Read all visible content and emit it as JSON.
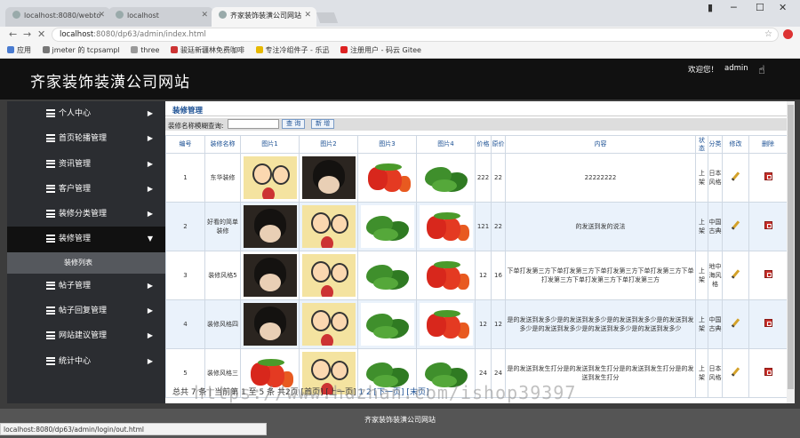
{
  "browser": {
    "tabs": [
      {
        "label": "localhost:8080/webto"
      },
      {
        "label": "localhost"
      },
      {
        "label": "齐家装饰装潢公司网站"
      }
    ],
    "url_host": "localhost",
    "url_path": ":8080/dp63/admin/index.html",
    "bookmarks": [
      "应用",
      "jmeter 的 tcpsampl",
      "three",
      "骏廷新疆林免费咖啡",
      "专注冷组件子 - 乐迅",
      "注册用户 - 码云 Gitee"
    ]
  },
  "header": {
    "title": "齐家装饰装潢公司网站",
    "welcome": "欢迎您！",
    "username": "admin"
  },
  "sidebar": {
    "items": [
      {
        "label": "个人中心"
      },
      {
        "label": "首页轮播管理"
      },
      {
        "label": "资讯管理"
      },
      {
        "label": "客户管理"
      },
      {
        "label": "装修分类管理"
      },
      {
        "label": "装修管理"
      },
      {
        "label": "帖子管理"
      },
      {
        "label": "帖子回复管理"
      },
      {
        "label": "网站建议管理"
      },
      {
        "label": "统计中心"
      }
    ],
    "sub_item": "装修列表"
  },
  "main": {
    "breadcrumb": "装修管理",
    "search_label": "装修名称模糊查询:",
    "search_value": "",
    "query_button": "查 询",
    "add_button": "新 增",
    "columns": [
      "编号",
      "装修名称",
      "图片1",
      "图片2",
      "图片3",
      "图片4",
      "价格",
      "原价",
      "内容",
      "状态",
      "分类",
      "修改",
      "删除"
    ],
    "rows": [
      {
        "id": "1",
        "name": "东华装修",
        "imgs": [
          "cartoon",
          "dark",
          "pepper",
          "spinach"
        ],
        "price": "222",
        "orig": "22",
        "content": "22222222",
        "status": "上架",
        "cat": "日本风格"
      },
      {
        "id": "2",
        "name": "好看的简单装修",
        "imgs": [
          "dark",
          "cartoon",
          "spinach",
          "pepper"
        ],
        "price": "121",
        "orig": "22",
        "content": "的发送到发的说法",
        "status": "上架",
        "cat": "中国古典"
      },
      {
        "id": "3",
        "name": "装修风格5",
        "imgs": [
          "dark",
          "cartoon",
          "spinach",
          "pepper"
        ],
        "price": "12",
        "orig": "16",
        "content": "下单打发第三方下单打发第三方下单打发第三方下单打发第三方下单打发第三方下单打发第三方下单打发第三方",
        "status": "上架",
        "cat": "地中海风格"
      },
      {
        "id": "4",
        "name": "装修风格四",
        "imgs": [
          "dark",
          "cartoon",
          "spinach",
          "pepper"
        ],
        "price": "12",
        "orig": "12",
        "content": "是的发送到发多少是的发送到发多少是的发送到发多少是的发送到发多少是的发送到发多少是的发送到发多少是的发送到发多少",
        "status": "上架",
        "cat": "中国古典"
      },
      {
        "id": "5",
        "name": "装修风格三",
        "imgs": [
          "pepper",
          "cartoon",
          "spinach",
          "spinach"
        ],
        "price": "24",
        "orig": "24",
        "content": "是的发送到发生打分是的发送到发生打分是的发送到发生打分是的发送到发生打分",
        "status": "上架",
        "cat": "日本风格"
      }
    ],
    "pager_text": "总共 7 条 | 当前第 1 至 5 条 共2页 [首页] [上一页]",
    "pager_page1": "1",
    "pager_page2": "2",
    "pager_links": "[下一页] [末页]"
  },
  "footer": {
    "text": "齐家装饰装潢公司网站",
    "status_url": "localhost:8080/dp63/admin/login/out.html"
  },
  "watermark": "https://www.huzhan.com/ishop39397"
}
